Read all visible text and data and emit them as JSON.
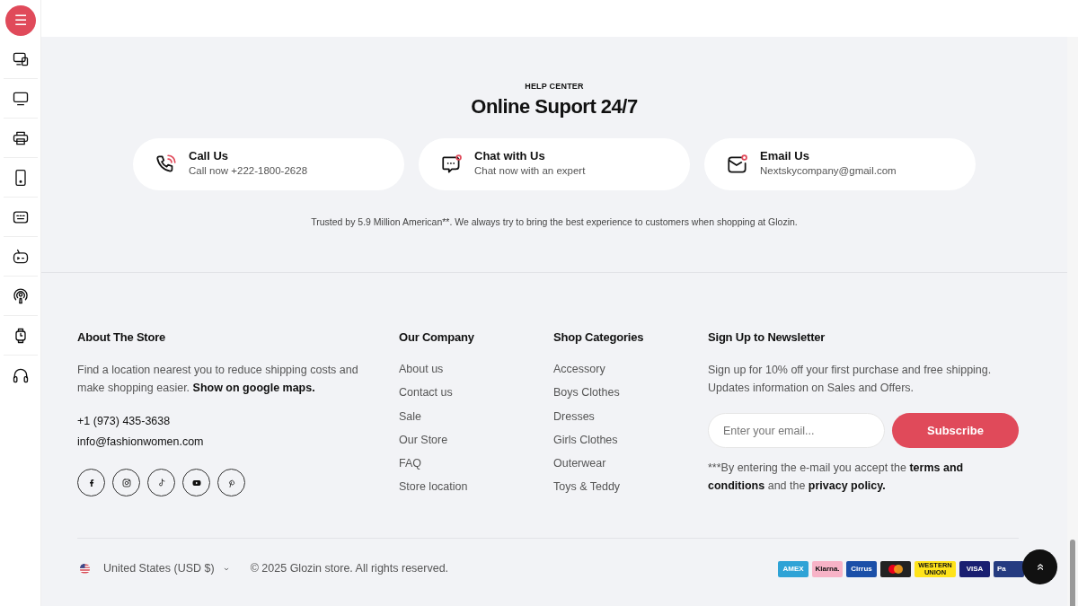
{
  "sidebar": {
    "menu_button": {
      "label": "☰"
    },
    "items": [
      {
        "kind": "devices"
      },
      {
        "kind": "monitor"
      },
      {
        "kind": "printer"
      },
      {
        "kind": "phone"
      },
      {
        "kind": "keyboard"
      },
      {
        "kind": "console"
      },
      {
        "kind": "podcast"
      },
      {
        "kind": "watch"
      },
      {
        "kind": "headphones"
      }
    ]
  },
  "help_center": {
    "eyebrow": "HELP CENTER",
    "title": "Online Suport 24/7",
    "contacts": [
      {
        "kind": "phone",
        "title": "Call Us",
        "subtitle": "Call now +222-1800-2628"
      },
      {
        "kind": "chat",
        "title": "Chat with Us",
        "subtitle": "Chat now with an expert"
      },
      {
        "kind": "email",
        "title": "Email Us",
        "subtitle": "Nextskycompany@gmail.com"
      }
    ],
    "trust_text": "Trusted by 5.9 Million American**. We always try to bring the best experience to customers when shopping at Glozin."
  },
  "footer": {
    "about": {
      "heading": "About The Store",
      "text": "Find a location nearest you to reduce shipping costs and make shopping easier. **Show on google maps.**",
      "phone": "+1 (973) 435-3638",
      "email": "info@fashionwomen.com",
      "socials": [
        {
          "kind": "facebook"
        },
        {
          "kind": "instagram"
        },
        {
          "kind": "tiktok"
        },
        {
          "kind": "youtube"
        },
        {
          "kind": "pinterest"
        }
      ]
    },
    "columns": [
      {
        "heading": "Our Company",
        "links": [
          "About us",
          "Contact us",
          "Sale",
          "Our Store",
          "FAQ",
          "Store location"
        ]
      },
      {
        "heading": "Shop Categories",
        "links": [
          "Accessory",
          "Boys Clothes",
          "Dresses",
          "Girls Clothes",
          "Outerwear",
          "Toys & Teddy"
        ]
      }
    ],
    "newsletter": {
      "heading": "Sign Up to Newsletter",
      "text": "Sign up for 10% off your first purchase and free shipping. Updates information on Sales and Offers.",
      "placeholder": "Enter your email...",
      "button": "Subscribe",
      "note": {
        "lead": "***By entering the e-mail you accept the",
        "terms_link": "terms and conditions",
        "joiner": "and the",
        "privacy_link": "privacy policy."
      }
    }
  },
  "bottom_bar": {
    "currency": "United States (USD $)",
    "copyright": "© 2025 Glozin store. All rights reserved.",
    "payments": [
      {
        "label": "AMEX",
        "color": "#2fa3d6"
      },
      {
        "label": "Klarna.",
        "color": "#f7b3c7"
      },
      {
        "label": "Cirrus",
        "color": "#1b4fa8"
      },
      {
        "kind": "mastercard",
        "color": "#222222"
      },
      {
        "label": "WESTERN UNION",
        "color": "#ffe31a"
      },
      {
        "label": "VISA",
        "color": "#1a1f71"
      },
      {
        "label": "Pa",
        "color": "#253b80"
      }
    ],
    "back_to_top": "»"
  }
}
